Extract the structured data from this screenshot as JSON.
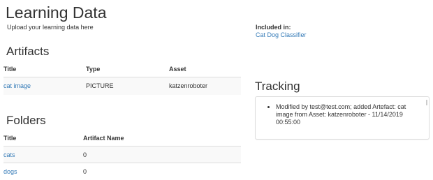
{
  "page": {
    "title": "Learning Data",
    "subtitle": "Upload your learning data here"
  },
  "included": {
    "label": "Included in:",
    "link": "Cat Dog Classifier"
  },
  "artifacts": {
    "title": "Artifacts",
    "headers": {
      "title": "Title",
      "type": "Type",
      "asset": "Asset"
    },
    "rows": [
      {
        "title": "cat image",
        "type": "PICTURE",
        "asset": "katzenroboter"
      }
    ]
  },
  "folders": {
    "title": "Folders",
    "headers": {
      "title": "Title",
      "artifact_name": "Artifact Name"
    },
    "rows": [
      {
        "title": "cats",
        "artifact_name": "0"
      },
      {
        "title": "dogs",
        "artifact_name": "0"
      }
    ]
  },
  "tracking": {
    "title": "Tracking",
    "entries": [
      "Modified by test@test.com; added Artefact: cat image from Asset: katzenroboter - 11/14/2019 00:55:00"
    ]
  },
  "colors": {
    "link": "#337ab7",
    "border": "#dddddd",
    "stripe": "#f9f9f9",
    "text": "#333333"
  }
}
